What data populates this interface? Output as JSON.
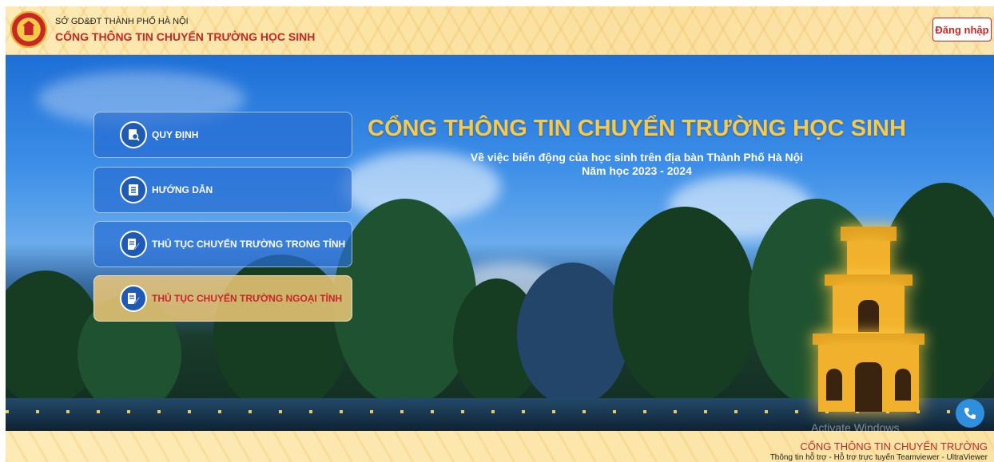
{
  "header": {
    "org_name": "SỞ GD&ĐT THÀNH PHỐ HÀ NỘI",
    "portal_name": "CỔNG THÔNG TIN CHUYỂN TRƯỜNG HỌC SINH",
    "login_label": "Đăng nhập"
  },
  "menu": [
    {
      "label": "QUY ĐỊNH",
      "icon": "search-document-icon"
    },
    {
      "label": "HƯỚNG DẪN",
      "icon": "notebook-icon"
    },
    {
      "label": "THỦ TỤC CHUYỂN TRƯỜNG TRONG TỈNH",
      "icon": "form-edit-icon"
    },
    {
      "label": "THỦ TỤC CHUYỂN TRƯỜNG NGOẠI TỈNH",
      "icon": "form-edit-icon"
    }
  ],
  "hero": {
    "title": "CỔNG THÔNG TIN CHUYỂN TRƯỜNG HỌC SINH",
    "subtitle": "Về việc biến động của học sinh trên địa bàn Thành Phố Hà Nội",
    "school_year": "Năm học 2023 - 2024"
  },
  "footer": {
    "watermark": "Activate Windows",
    "title": "CỔNG THÔNG TIN CHUYỂN TRƯỜNG",
    "info": "Thông tin hỗ trợ - Hỗ trợ trực tuyến Teamviewer - UltraViewer"
  },
  "colors": {
    "accent_red": "#c62828",
    "accent_gold": "#f7c948",
    "button_blue": "#286ed2"
  }
}
